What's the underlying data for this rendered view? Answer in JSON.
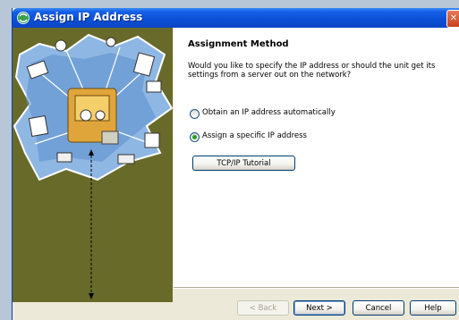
{
  "window": {
    "title": "Assign IP Address"
  },
  "header": {
    "heading": "Assignment Method"
  },
  "main": {
    "question": "Would you like to specify the IP address or should the unit get its settings from a server out on the network?",
    "options": [
      {
        "label": "Obtain an IP address automatically",
        "selected": false
      },
      {
        "label": "Assign a specific IP address",
        "selected": true
      }
    ],
    "tutorial_button": "TCP/IP Tutorial"
  },
  "footer": {
    "back_label": "< Back",
    "next_label": "Next >",
    "cancel_label": "Cancel",
    "help_label": "Help"
  },
  "icons": {
    "app": "network-app-icon",
    "close": "close-icon"
  },
  "colors": {
    "titlebar": "#0a4fd6",
    "side_panel": "#686a2a",
    "content_bg": "#ffffff"
  }
}
